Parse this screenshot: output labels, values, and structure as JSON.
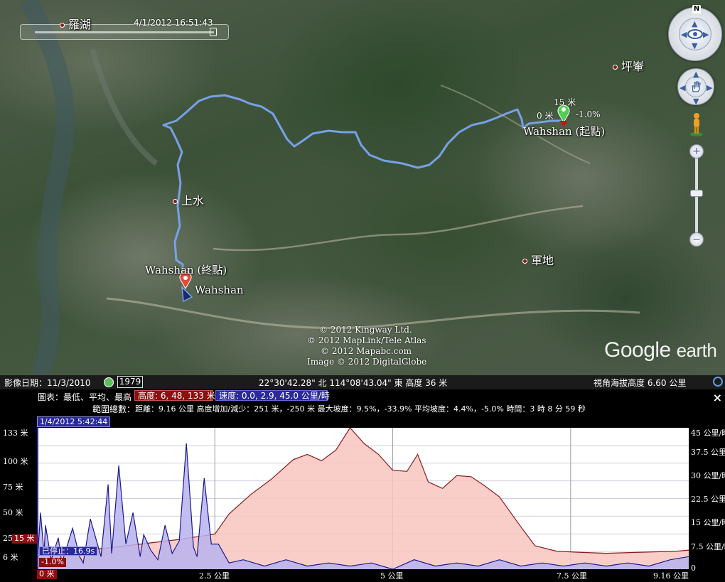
{
  "map": {
    "time_slider": {
      "place": "羅湖",
      "datetime": "4/1/2012  16:51:43"
    },
    "places": {
      "lo_wu": "羅湖",
      "ping_che": "坪輋",
      "sheung_shui": "上水",
      "kwan_tei": "軍地"
    },
    "markers": {
      "start_label": "Wahshan (起點)",
      "end_label": "Wahshan (終點)",
      "current_label": "Wahshan",
      "start_elev": "15 米",
      "start_left": "0 米",
      "start_right": "-1.0%"
    },
    "attribution": [
      "© 2012 Kingway Ltd.",
      "© 2012 MapLink/Tele Atlas",
      "© 2012 Mapabc.com",
      "Image © 2012 DigitalGlobe"
    ],
    "logo": {
      "google": "Google",
      "earth": "earth"
    },
    "compass_letter": "N"
  },
  "status_bar": {
    "imagery_date": "影像日期：11/3/2010",
    "year": "1979",
    "coords": "22°30'42.28\" 北  114°08'43.04\" 東  高度    36 米",
    "eye_alt": "視角海拔高度      6.60 公里"
  },
  "elevation_panel": {
    "chart_label": "圖表：最低、平均、最高",
    "alt_pill": "高度: 6, 48, 133 米",
    "speed_pill": "速度: 0.0, 2.9, 45.0 公里/時",
    "summary_label": "範圍總數：",
    "summary": "距離：9.16 公里 高度增加/減少：251 米，-250 米 最大坡度：9.5%，-33.9% 平均坡度：4.4%，-5.0% 時間：3 時 8 分 59 秒",
    "cursor_date": "1/4/2012 5:42:44",
    "cursor_alt": "15 米",
    "cursor_speed": "已停止：16.9s",
    "cursor_grade": "-1.0%",
    "cursor_x": "0 米",
    "close": "×"
  },
  "chart_data": {
    "type": "area",
    "xlabel": "",
    "ylabel": "",
    "x_ticks": [
      "0 米",
      "2.5 公里",
      "5 公里",
      "7.5 公里",
      "9.16 公里"
    ],
    "y_ticks_left": [
      "133 米",
      "100 米",
      "75 米",
      "50 米",
      "25 米",
      "6 米"
    ],
    "y_ticks_right": [
      "45 公里/時",
      "37.5 公里/時",
      "30 公里/時",
      "22.5 公里/時",
      "15 公里/時",
      "7.5 公里/時",
      "0"
    ],
    "xlim": [
      0,
      9.16
    ],
    "ylim_left": [
      0,
      133
    ],
    "ylim_right": [
      0,
      45
    ],
    "series": [
      {
        "name": "高度",
        "color": "#8b1a1a",
        "fill": "#f8c6c0",
        "x": [
          0,
          0.5,
          1.0,
          1.5,
          2.0,
          2.5,
          2.7,
          3.0,
          3.3,
          3.6,
          3.8,
          4.0,
          4.2,
          4.4,
          4.6,
          4.8,
          5.0,
          5.2,
          5.35,
          5.5,
          5.7,
          5.9,
          6.1,
          6.3,
          6.5,
          6.8,
          7.0,
          7.3,
          7.6,
          8.0,
          8.5,
          9.0,
          9.16
        ],
        "values": [
          15,
          17,
          20,
          24,
          28,
          33,
          52,
          70,
          85,
          103,
          108,
          102,
          112,
          133,
          118,
          108,
          93,
          92,
          108,
          82,
          76,
          88,
          87,
          78,
          68,
          40,
          22,
          17,
          16,
          15,
          16,
          17,
          18
        ]
      },
      {
        "name": "速度",
        "color": "#1a1a8a",
        "fill": "#b8b3ef",
        "x": [
          0,
          0.05,
          0.1,
          0.12,
          0.2,
          0.3,
          0.35,
          0.5,
          0.6,
          0.65,
          0.75,
          0.9,
          1.0,
          1.05,
          1.15,
          1.25,
          1.35,
          1.45,
          1.5,
          1.6,
          1.7,
          1.8,
          1.9,
          2.0,
          2.1,
          2.2,
          2.25,
          2.35,
          2.45,
          2.55,
          2.7,
          2.9,
          3.2,
          3.5,
          3.8,
          4.1,
          4.4,
          4.7,
          5.0,
          5.3,
          5.6,
          5.9,
          6.2,
          6.5,
          6.8,
          7.1,
          7.4,
          7.7,
          8.0,
          8.3,
          8.6,
          8.9,
          9.16
        ],
        "values": [
          0,
          18,
          5,
          14,
          3,
          10,
          2,
          13,
          4,
          2,
          16,
          4,
          27,
          5,
          33,
          8,
          18,
          4,
          11,
          6,
          3,
          14,
          5,
          9,
          40,
          7,
          4,
          29,
          8,
          8,
          2,
          3,
          1,
          3,
          1,
          2,
          1,
          2,
          0,
          3,
          1,
          2,
          1,
          3,
          1,
          2,
          1,
          2,
          1,
          2,
          1,
          3,
          4
        ]
      }
    ]
  }
}
